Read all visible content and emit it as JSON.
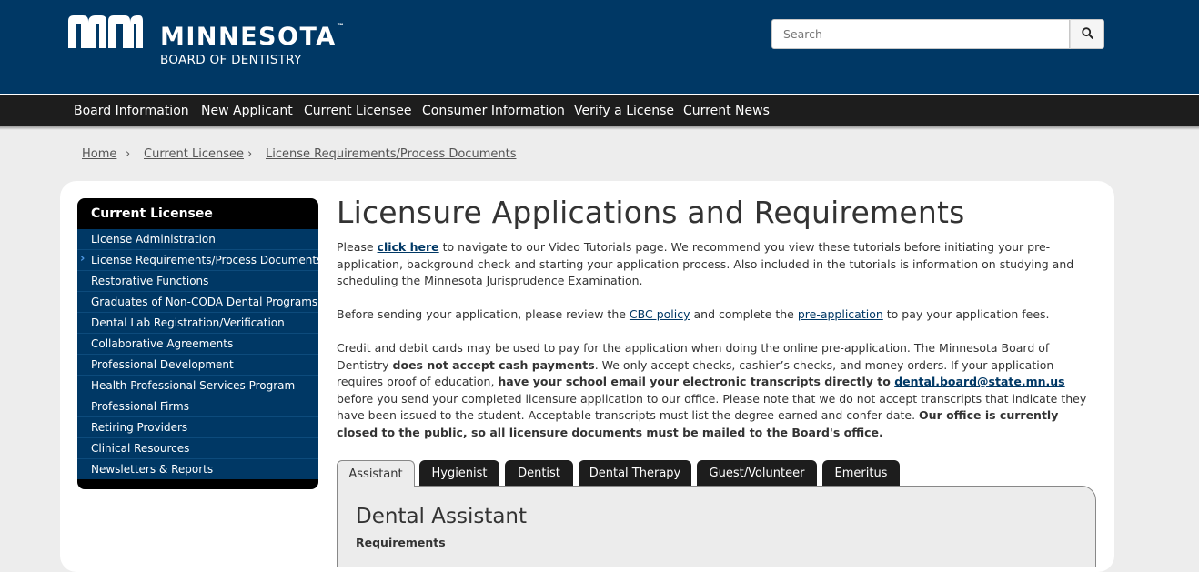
{
  "header": {
    "logo_word": "MINNESOTA",
    "logo_tm": "™",
    "logo_sub": "BOARD OF DENTISTRY",
    "search_placeholder": "Search",
    "brand_color": "#003865"
  },
  "nav": {
    "items": [
      "Board Information",
      "New Applicant",
      "Current Licensee",
      "Consumer Information",
      "Verify a License",
      "Current News"
    ]
  },
  "breadcrumb": {
    "items": [
      "Home",
      "Current Licensee",
      "License Requirements/Process Documents"
    ],
    "separator": "›"
  },
  "sidebar": {
    "title": "Current Licensee",
    "active_index": 1,
    "items": [
      "License Administration",
      "License Requirements/Process Documents",
      "Restorative Functions",
      "Graduates of Non-CODA Dental Programs",
      "Dental Lab Registration/Verification",
      "Collaborative Agreements",
      "Professional Development",
      "Health Professional Services Program",
      "Professional Firms",
      "Retiring Providers",
      "Clinical Resources",
      "Newsletters & Reports"
    ]
  },
  "main": {
    "title": "Licensure Applications and Requirements",
    "p1": {
      "pre": "Please ",
      "link": "click here",
      "post": " to navigate to our Video Tutorials page. We recommend you view these tutorials before initiating your pre-application, background check and starting your application process. Also included in the tutorials is information on studying and scheduling the Minnesota Jurisprudence Examination."
    },
    "p2": {
      "pre": "Before sending your application, please review the ",
      "link1": "CBC policy",
      "mid": " and complete the ",
      "link2": "pre-application",
      "post": " to pay your application fees."
    },
    "p3": {
      "t1": "Credit and debit cards may be used to pay for the application when doing the online pre-application. The Minnesota Board of Dentistry ",
      "b1": "does not accept cash payments",
      "t2": ". We only accept checks, cashier’s checks, and money orders. If your application requires proof of education, ",
      "b2": "have your school email your electronic transcripts directly to ",
      "email": "dental.board@state.mn.us",
      "t3": " before you send your completed licensure application to our office. Please note that we do not accept transcripts that indicate they have been issued to the student. Acceptable transcripts must list the degree earned and confer date. ",
      "b3": "Our office is currently closed to the public, so all licensure documents must be mailed to the Board's office."
    },
    "tabs": [
      "Assistant",
      "Hygienist",
      "Dentist",
      "Dental Therapy",
      "Guest/Volunteer",
      "Emeritus"
    ],
    "active_tab": 0,
    "panel_title": "Dental Assistant",
    "panel_sub": "Requirements"
  }
}
